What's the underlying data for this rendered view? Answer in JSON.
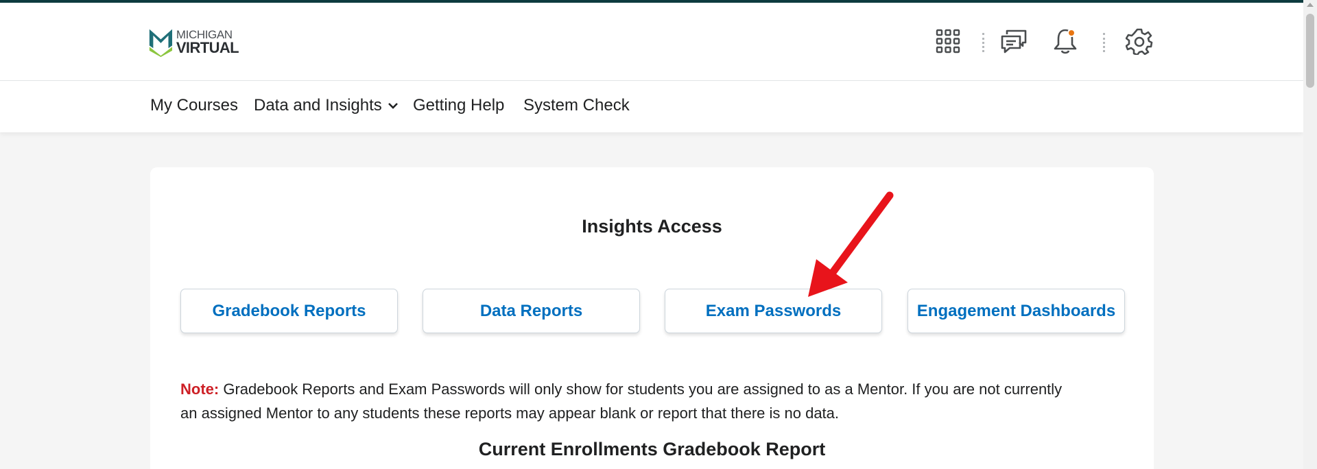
{
  "header": {
    "logo_line1": "MICHIGAN",
    "logo_line2": "VIRTUAL",
    "icons": [
      "waffle-grid-icon",
      "chat-icon",
      "bell-icon",
      "gear-icon"
    ],
    "notification_dot_color": "#e87511"
  },
  "nav": {
    "items": [
      {
        "label": "My Courses"
      },
      {
        "label": "Data and Insights",
        "has_dropdown": true
      },
      {
        "label": "Getting Help"
      },
      {
        "label": "System Check"
      }
    ]
  },
  "card": {
    "title": "Insights Access",
    "buttons": [
      {
        "label": "Gradebook Reports"
      },
      {
        "label": "Data Reports"
      },
      {
        "label": "Exam Passwords"
      },
      {
        "label": "Engagement Dashboards"
      }
    ],
    "note_label": "Note:",
    "note_text": "Gradebook Reports and Exam Passwords will only show for students you are assigned to as a Mentor. If you are not currently an assigned Mentor to any students these reports may appear blank or report that there is no data.",
    "subtitle": "Current Enrollments Gradebook Report"
  },
  "colors": {
    "top_bar": "#0d3b3f",
    "link_blue": "#006fbf",
    "note_red": "#cd2026",
    "arrow_red": "#e8141b",
    "logo_teal": "#1f6f78",
    "logo_green": "#8cc63f"
  }
}
